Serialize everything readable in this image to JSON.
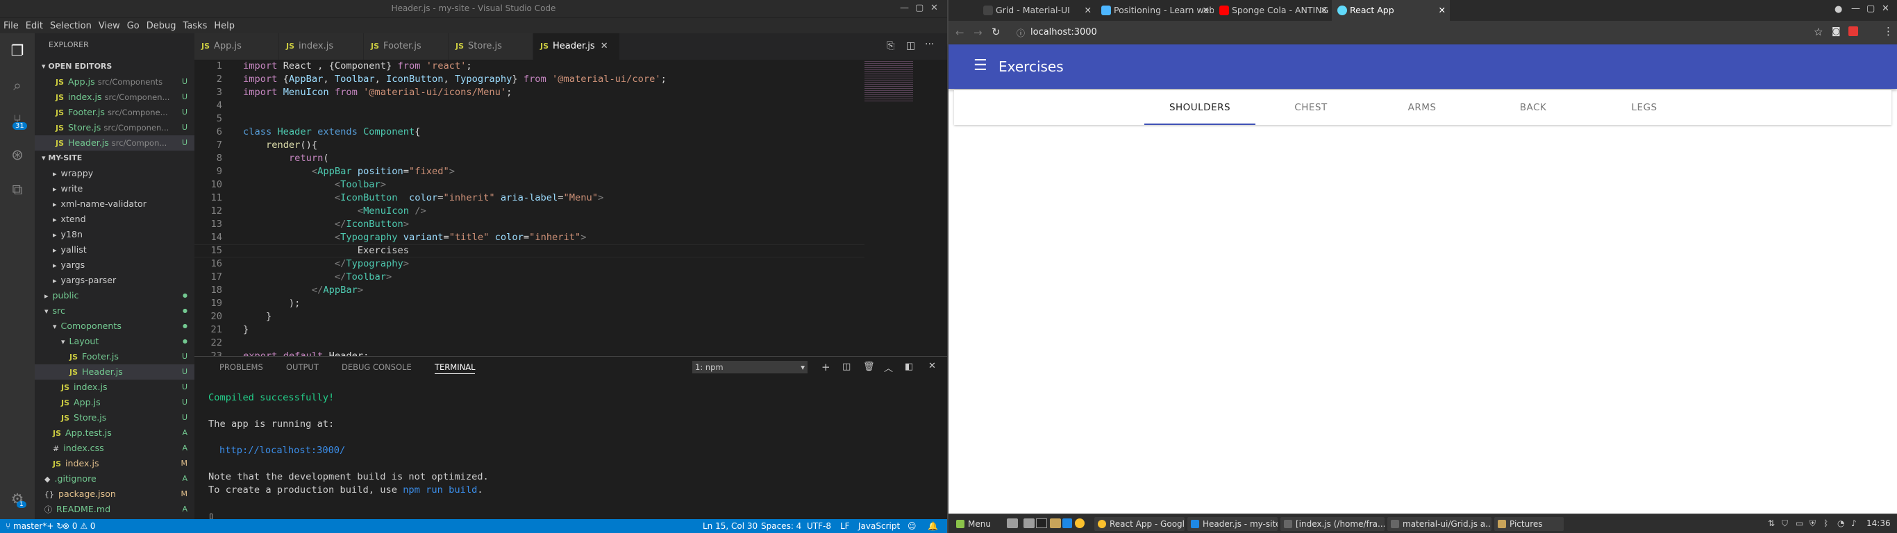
{
  "vscode": {
    "window_title": "Header.js - my-site - Visual Studio Code",
    "menu": [
      "File",
      "Edit",
      "Selection",
      "View",
      "Go",
      "Debug",
      "Tasks",
      "Help"
    ],
    "explorer_title": "EXPLORER",
    "open_editors_title": "OPEN EDITORS",
    "open_editors": [
      {
        "name": "App.js",
        "path": "src/Components",
        "status": "U"
      },
      {
        "name": "index.js",
        "path": "src/Componen...",
        "status": "U"
      },
      {
        "name": "Footer.js",
        "path": "src/Compone...",
        "status": "U"
      },
      {
        "name": "Store.js",
        "path": "src/Componen...",
        "status": "U"
      },
      {
        "name": "Header.js",
        "path": "src/Compon...",
        "status": "U"
      }
    ],
    "project_title": "MY-SITE",
    "tree": [
      {
        "name": "wrappy",
        "status": ""
      },
      {
        "name": "write",
        "status": ""
      },
      {
        "name": "xml-name-validator",
        "status": ""
      },
      {
        "name": "xtend",
        "status": ""
      },
      {
        "name": "y18n",
        "status": ""
      },
      {
        "name": "yallist",
        "status": ""
      },
      {
        "name": "yargs",
        "status": ""
      },
      {
        "name": "yargs-parser",
        "status": ""
      },
      {
        "name": "public",
        "status": ""
      },
      {
        "name": "src",
        "status": ""
      },
      {
        "name": "Comoponents",
        "status": ""
      },
      {
        "name": "Layout",
        "status": ""
      },
      {
        "name": "Footer.js",
        "status": "U"
      },
      {
        "name": "Header.js",
        "status": "U"
      },
      {
        "name": "index.js",
        "status": "U"
      },
      {
        "name": "App.js",
        "status": "U"
      },
      {
        "name": "Store.js",
        "status": "U"
      },
      {
        "name": "App.test.js",
        "status": "A"
      },
      {
        "name": "index.css",
        "status": "A"
      },
      {
        "name": "index.js",
        "status": "M"
      },
      {
        "name": ".gitignore",
        "status": "A"
      },
      {
        "name": "package.json",
        "status": "M"
      },
      {
        "name": "README.md",
        "status": "A"
      }
    ],
    "scm_badge": "31",
    "settings_badge": "1",
    "tabs": [
      "App.js",
      "index.js",
      "Footer.js",
      "Store.js",
      "Header.js"
    ],
    "line_numbers": [
      "1",
      "2",
      "3",
      "4",
      "5",
      "6",
      "7",
      "8",
      "9",
      "10",
      "11",
      "12",
      "13",
      "14",
      "15",
      "16",
      "17",
      "18",
      "19",
      "20",
      "21",
      "22",
      "23"
    ],
    "panel_tabs": [
      "PROBLEMS",
      "OUTPUT",
      "DEBUG CONSOLE",
      "TERMINAL"
    ],
    "terminal_select": "1: npm",
    "terminal": {
      "compiled": "Compiled successfully!",
      "running": "The app is running at:",
      "url": "http://localhost:3000/",
      "note1": "Note that the development build is not optimized.",
      "note2_pre": "To create a production build, use ",
      "note2_cmd": "npm run build",
      "note2_post": "."
    },
    "status": {
      "branch": "master*+",
      "errors": "0",
      "warnings": "0",
      "position": "Ln 15, Col 30",
      "spaces": "Spaces: 4",
      "encoding": "UTF-8",
      "eol": "LF",
      "language": "JavaScript"
    },
    "colors": {
      "accent": "#007acc",
      "green": "#73c991",
      "yellow": "#e2c08d"
    }
  },
  "browser": {
    "tabs": [
      {
        "title": "Grid - Material-UI",
        "color": "#444"
      },
      {
        "title": "Positioning - Learn web",
        "color": "#4db6ff"
      },
      {
        "title": "Sponge Cola - ANTING",
        "color": "#ff0000"
      },
      {
        "title": "React App",
        "color": "#61dafb"
      }
    ],
    "url": "localhost:3000",
    "app_title": "Exercises",
    "muscle_tabs": [
      "SHOULDERS",
      "CHEST",
      "ARMS",
      "BACK",
      "LEGS"
    ],
    "selected_tab": "SHOULDERS",
    "app_color": "#3f51b5"
  },
  "taskbar": {
    "menu": "Menu",
    "items": [
      "React App - Google...",
      "Header.js - my-site ...",
      "[index.js (/home/fra...",
      "material-ui/Grid.js a...",
      "Pictures"
    ],
    "clock": "14:36"
  }
}
